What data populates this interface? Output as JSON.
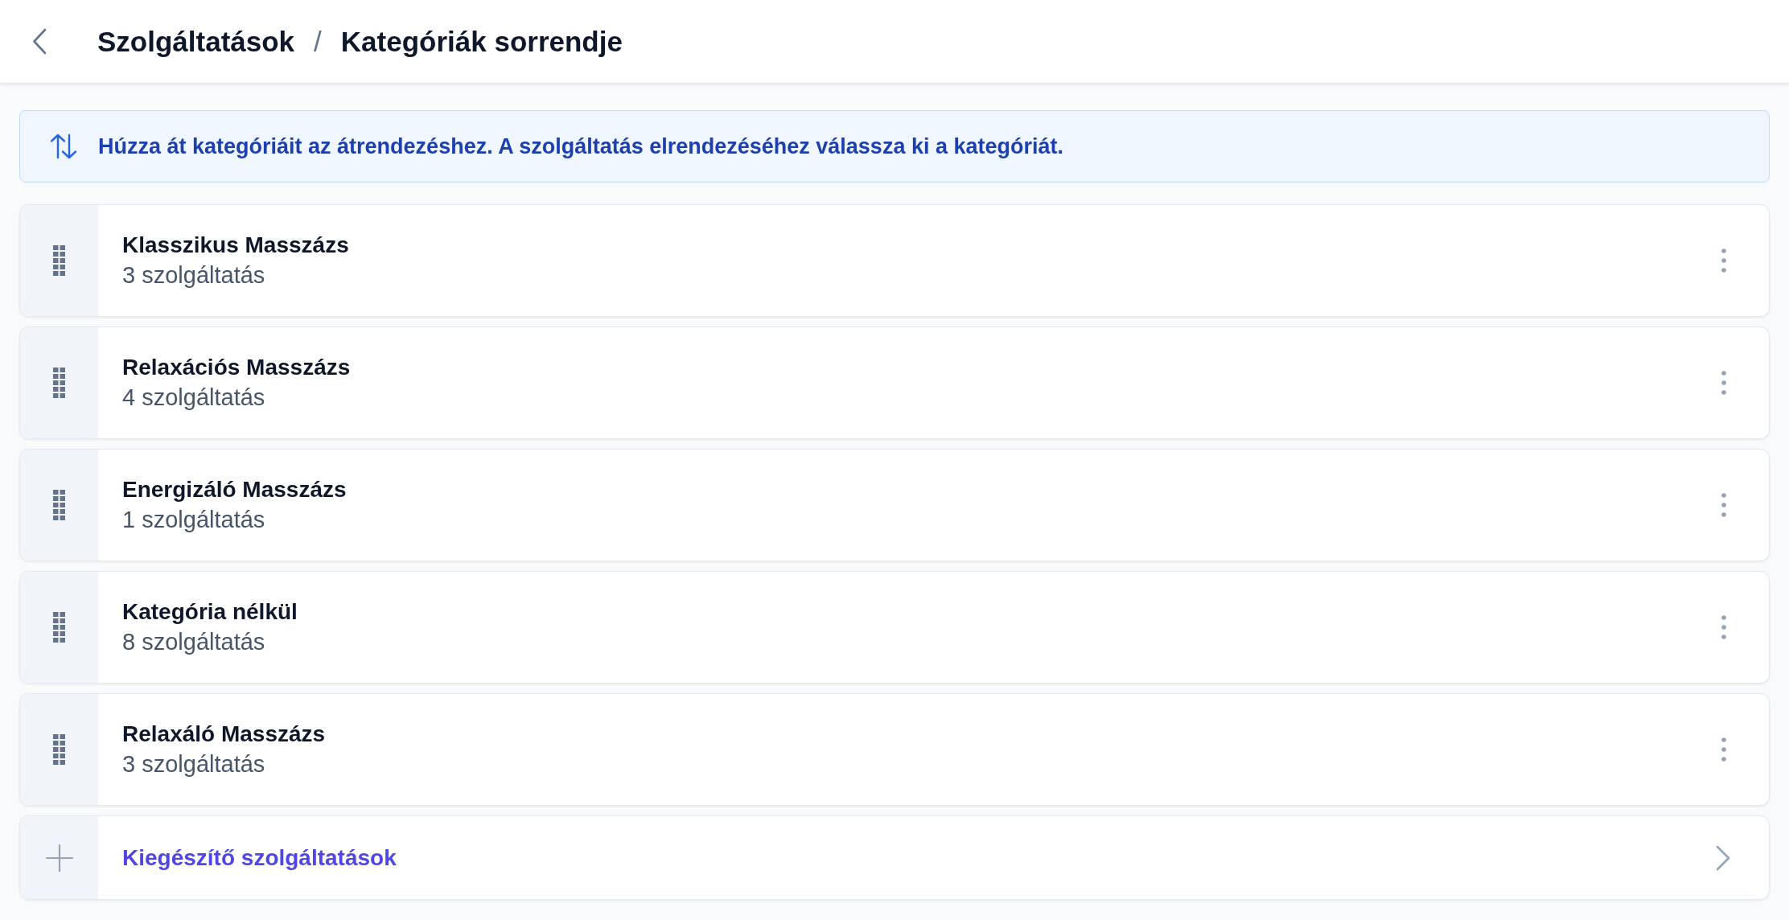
{
  "header": {
    "parent": "Szolgáltatások",
    "separator": "/",
    "current": "Kategóriák sorrendje"
  },
  "info_banner": {
    "text": "Húzza át kategóriáit az átrendezéshez. A szolgáltatás elrendezéséhez válassza ki a kategóriát."
  },
  "categories": [
    {
      "name": "Klasszikus Masszázs",
      "count": "3 szolgáltatás"
    },
    {
      "name": "Relaxációs Masszázs",
      "count": "4 szolgáltatás"
    },
    {
      "name": "Energizáló Masszázs",
      "count": "1 szolgáltatás"
    },
    {
      "name": "Kategória nélkül",
      "count": "8 szolgáltatás"
    },
    {
      "name": "Relaxáló Masszázs",
      "count": "3 szolgáltatás"
    }
  ],
  "extras_row": {
    "label": "Kiegészítő szolgáltatások"
  }
}
